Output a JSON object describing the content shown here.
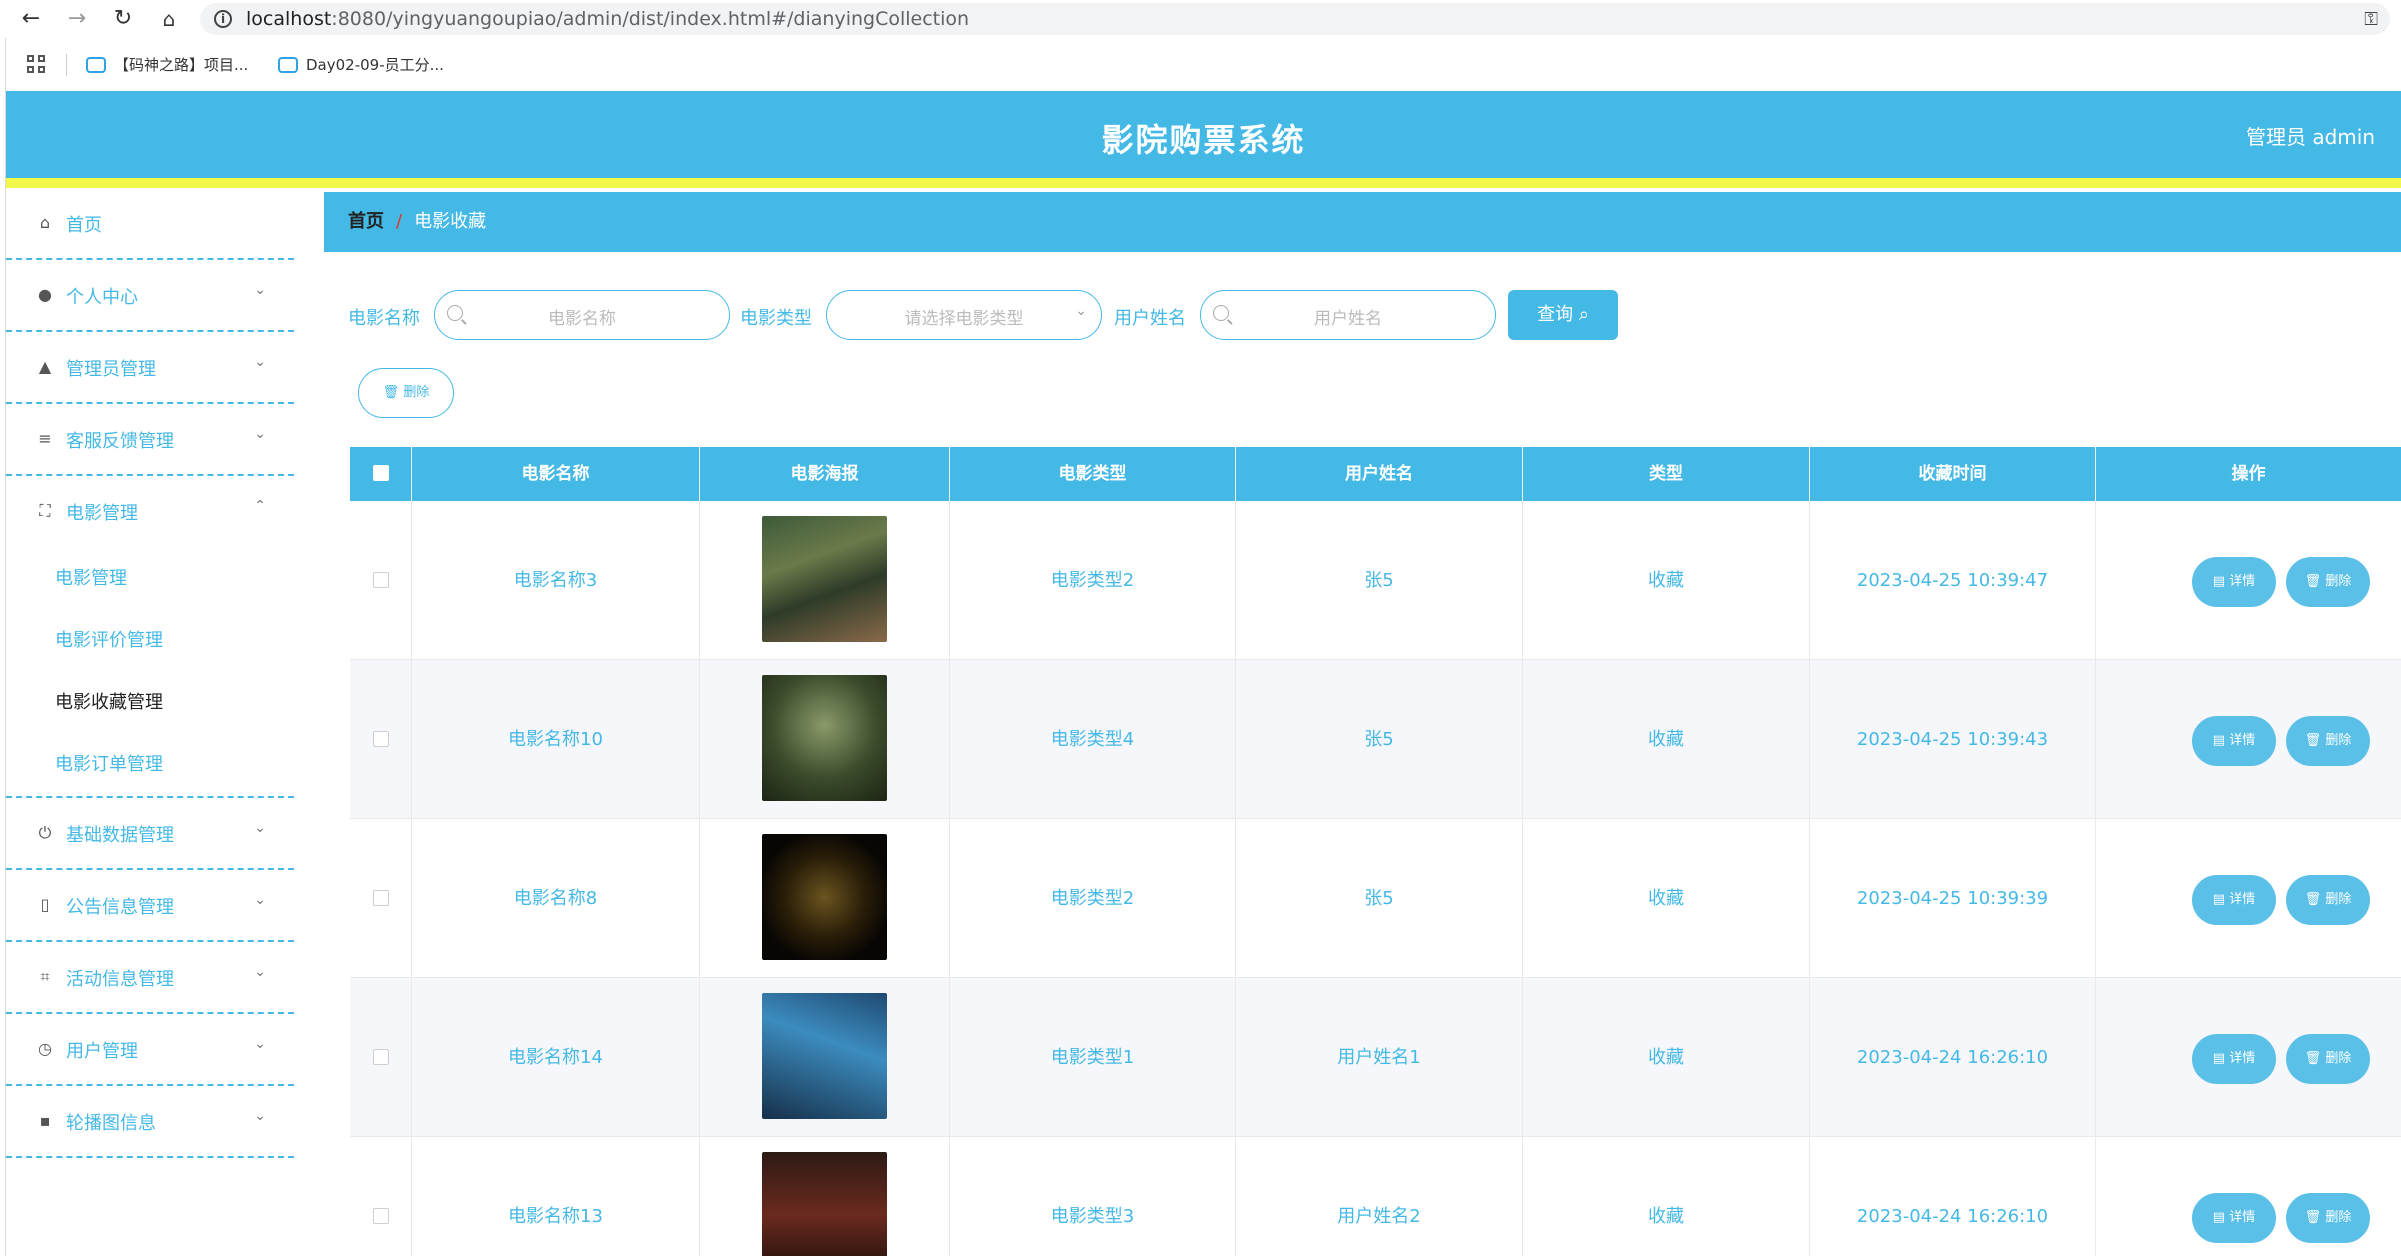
{
  "browser": {
    "url_host": "localhost",
    "url_rest": ":8080/yingyuangoupiao/admin/dist/index.html#/dianyingCollection",
    "bookmarks": [
      "【码神之路】项目...",
      "Day02-09-员工分..."
    ]
  },
  "header": {
    "title": "影院购票系统",
    "user": "管理员 admin"
  },
  "sidebar": {
    "items": [
      {
        "label": "首页",
        "icon": "home-icon"
      },
      {
        "label": "个人中心",
        "icon": "user-icon"
      },
      {
        "label": "管理员管理",
        "icon": "admin-icon"
      },
      {
        "label": "客服反馈管理",
        "icon": "list-icon"
      },
      {
        "label": "电影管理",
        "icon": "fullscreen-icon"
      },
      {
        "label": "基础数据管理",
        "icon": "power-icon"
      },
      {
        "label": "公告信息管理",
        "icon": "microphone-icon"
      },
      {
        "label": "活动信息管理",
        "icon": "crop-icon"
      },
      {
        "label": "用户管理",
        "icon": "clock-icon"
      },
      {
        "label": "轮播图信息",
        "icon": "chat-icon"
      }
    ],
    "submenu": [
      "电影管理",
      "电影评价管理",
      "电影收藏管理",
      "电影订单管理"
    ]
  },
  "breadcrumb": {
    "home": "首页",
    "separator": "/",
    "current": "电影收藏"
  },
  "search": {
    "name_label": "电影名称",
    "name_placeholder": "电影名称",
    "type_label": "电影类型",
    "type_placeholder": "请选择电影类型",
    "user_label": "用户姓名",
    "user_placeholder": "用户姓名",
    "query_label": "查询"
  },
  "toolbar": {
    "delete_label": "删除"
  },
  "table": {
    "headers": [
      "电影名称",
      "电影海报",
      "电影类型",
      "用户姓名",
      "类型",
      "收藏时间",
      "操作"
    ],
    "detail_label": "详情",
    "delete_label": "删除",
    "rows": [
      {
        "name": "电影名称3",
        "type": "电影类型2",
        "user": "张5",
        "kind": "收藏",
        "time": "2023-04-25 10:39:47"
      },
      {
        "name": "电影名称10",
        "type": "电影类型4",
        "user": "张5",
        "kind": "收藏",
        "time": "2023-04-25 10:39:43"
      },
      {
        "name": "电影名称8",
        "type": "电影类型2",
        "user": "张5",
        "kind": "收藏",
        "time": "2023-04-25 10:39:39"
      },
      {
        "name": "电影名称14",
        "type": "电影类型1",
        "user": "用户姓名1",
        "kind": "收藏",
        "time": "2023-04-24 16:26:10"
      },
      {
        "name": "电影名称13",
        "type": "电影类型3",
        "user": "用户姓名2",
        "kind": "收藏",
        "time": "2023-04-24 16:26:10"
      }
    ]
  },
  "colors": {
    "primary": "#45b9e6",
    "accent_bar": "#f3f94a",
    "separator_red": "#e2362b"
  }
}
